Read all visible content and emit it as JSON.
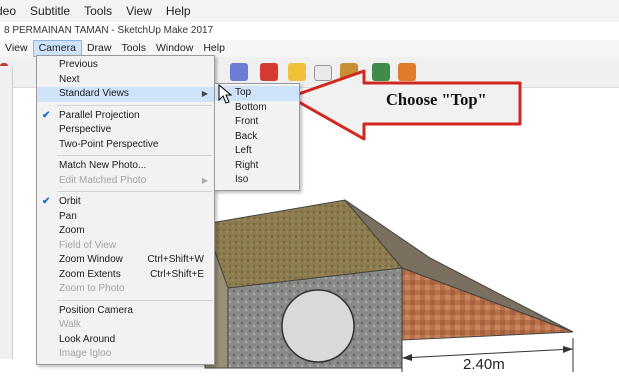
{
  "outer_menu": [
    "deo",
    "Subtitle",
    "Tools",
    "View",
    "Help"
  ],
  "window_title": "8 PERMAINAN TAMAN - SketchUp Make 2017",
  "sketchup_menu": [
    {
      "label": "View",
      "active": false
    },
    {
      "label": "Camera",
      "active": true
    },
    {
      "label": "Draw",
      "active": false
    },
    {
      "label": "Tools",
      "active": false
    },
    {
      "label": "Window",
      "active": false
    },
    {
      "label": "Help",
      "active": false
    }
  ],
  "camera_menu": {
    "items": [
      {
        "label": "Previous",
        "enabled": true
      },
      {
        "label": "Next",
        "enabled": true
      },
      {
        "label": "Standard Views",
        "enabled": true,
        "submenu": true,
        "highlighted": true
      },
      {
        "separator": true
      },
      {
        "label": "Parallel Projection",
        "enabled": true,
        "checked": true
      },
      {
        "label": "Perspective",
        "enabled": true
      },
      {
        "label": "Two-Point Perspective",
        "enabled": true
      },
      {
        "separator": true
      },
      {
        "label": "Match New Photo...",
        "enabled": true
      },
      {
        "label": "Edit Matched Photo",
        "enabled": false,
        "submenu": true
      },
      {
        "separator": true
      },
      {
        "label": "Orbit",
        "enabled": true,
        "checked": true
      },
      {
        "label": "Pan",
        "enabled": true
      },
      {
        "label": "Zoom",
        "enabled": true
      },
      {
        "label": "Field of View",
        "enabled": false
      },
      {
        "label": "Zoom Window",
        "enabled": true,
        "shortcut": "Ctrl+Shift+W"
      },
      {
        "label": "Zoom Extents",
        "enabled": true,
        "shortcut": "Ctrl+Shift+E"
      },
      {
        "label": "Zoom to Photo",
        "enabled": false
      },
      {
        "separator": true
      },
      {
        "label": "Position Camera",
        "enabled": true
      },
      {
        "label": "Walk",
        "enabled": false
      },
      {
        "label": "Look Around",
        "enabled": true
      },
      {
        "label": "Image Igloo",
        "enabled": false
      }
    ]
  },
  "standard_views_menu": {
    "items": [
      {
        "label": "Top",
        "highlighted": true
      },
      {
        "label": "Bottom"
      },
      {
        "label": "Front"
      },
      {
        "label": "Back"
      },
      {
        "label": "Left"
      },
      {
        "label": "Right"
      },
      {
        "label": "Iso"
      }
    ]
  },
  "callout": {
    "text": "Choose \"Top\"",
    "fill_color": "#f1f1f1",
    "stroke_color": "#d1271f"
  },
  "dimension_label": "2.40m",
  "colors": {
    "menu_highlight": "#cfe3fb",
    "check": "#1e73d2",
    "grass": "#8c7a4d",
    "stone": "#8a8a88",
    "brick": "#b9714a"
  }
}
